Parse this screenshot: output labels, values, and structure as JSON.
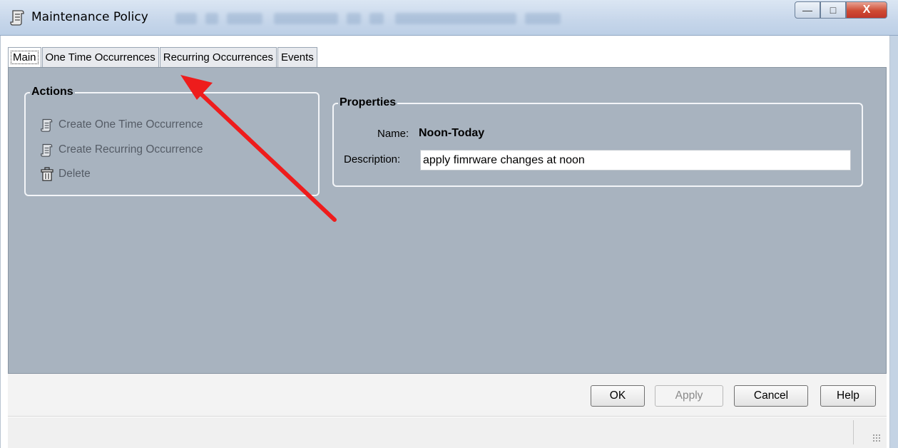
{
  "window": {
    "title": "Maintenance Policy",
    "minimize_label": "—",
    "maximize_label": "□",
    "close_label": "X"
  },
  "tabs": [
    {
      "label": "Main"
    },
    {
      "label": "One Time Occurrences"
    },
    {
      "label": "Recurring Occurrences"
    },
    {
      "label": "Events"
    }
  ],
  "actions": {
    "legend": "Actions",
    "items": [
      {
        "label": "Create One Time Occurrence",
        "icon": "scroll-icon"
      },
      {
        "label": "Create Recurring Occurrence",
        "icon": "scroll-icon"
      },
      {
        "label": "Delete",
        "icon": "trash-icon"
      }
    ]
  },
  "properties": {
    "legend": "Properties",
    "name_label": "Name:",
    "name_value": "Noon-Today",
    "description_label": "Description:",
    "description_value": "apply fimrware changes at noon"
  },
  "buttons": {
    "ok": "OK",
    "apply": "Apply",
    "cancel": "Cancel",
    "help": "Help"
  },
  "colors": {
    "panel_bg": "#a8b3bf",
    "annotation_arrow": "#ee1c1c"
  }
}
